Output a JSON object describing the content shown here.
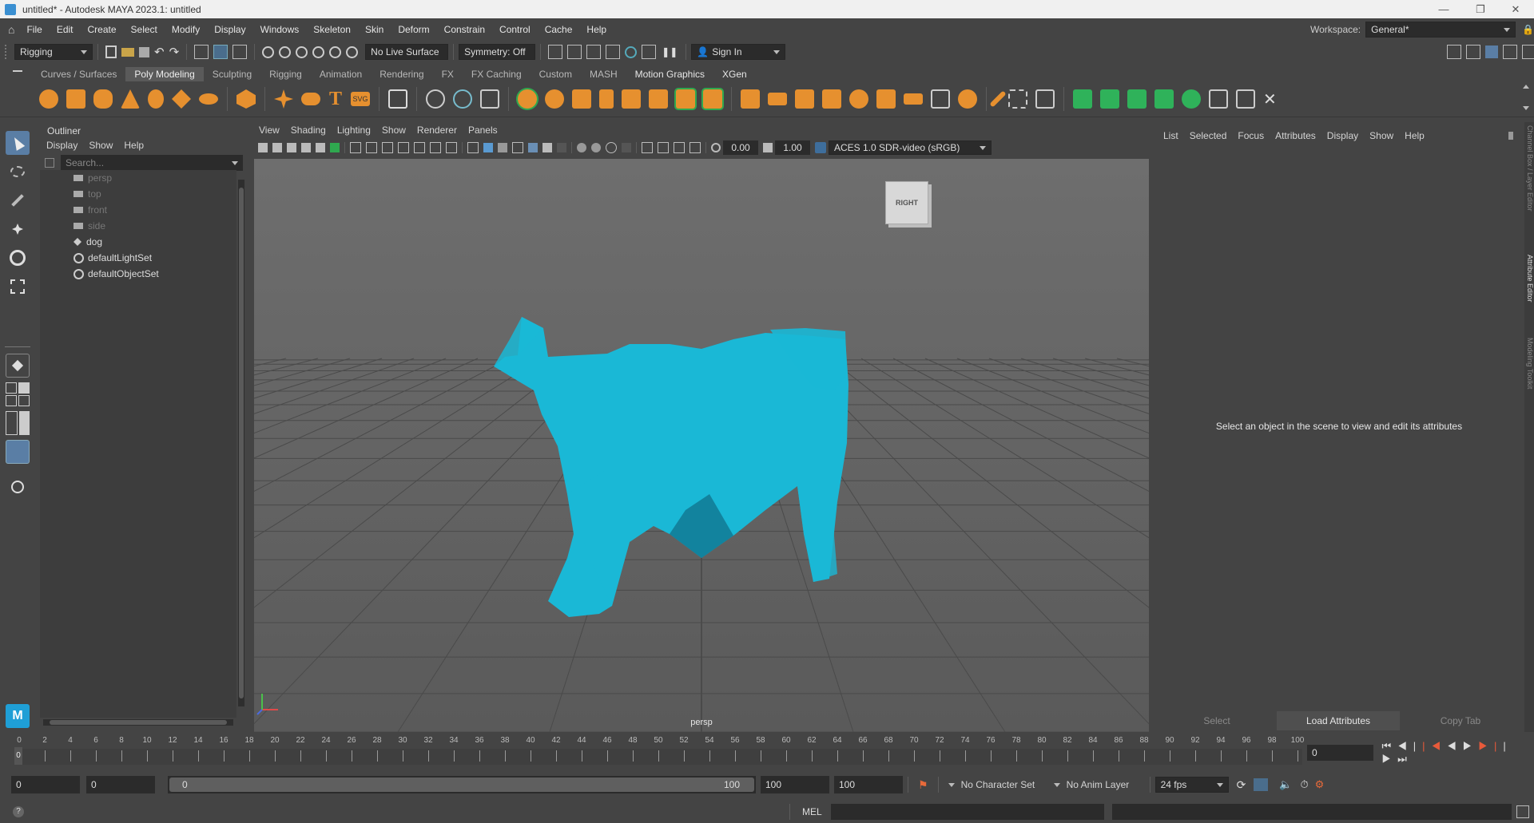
{
  "window": {
    "title": "untitled* - Autodesk MAYA 2023.1: untitled"
  },
  "menubar": {
    "items": [
      "File",
      "Edit",
      "Create",
      "Select",
      "Modify",
      "Display",
      "Windows",
      "Skeleton",
      "Skin",
      "Deform",
      "Constrain",
      "Control",
      "Cache",
      "Help"
    ],
    "workspace_label": "Workspace:",
    "workspace_value": "General*"
  },
  "statusline": {
    "menuset": "Rigging",
    "live_surface": "No Live Surface",
    "symmetry": "Symmetry: Off",
    "sign_in": "Sign In"
  },
  "shelf": {
    "tabs": [
      "Curves / Surfaces",
      "Poly Modeling",
      "Sculpting",
      "Rigging",
      "Animation",
      "Rendering",
      "FX",
      "FX Caching",
      "Custom",
      "MASH",
      "Motion Graphics",
      "XGen"
    ],
    "active_tab": "Poly Modeling"
  },
  "outliner": {
    "title": "Outliner",
    "menu": [
      "Display",
      "Show",
      "Help"
    ],
    "search_placeholder": "Search...",
    "items": [
      {
        "label": "persp",
        "type": "camera",
        "dim": true
      },
      {
        "label": "top",
        "type": "camera",
        "dim": true
      },
      {
        "label": "front",
        "type": "camera",
        "dim": true
      },
      {
        "label": "side",
        "type": "camera",
        "dim": true
      },
      {
        "label": "dog",
        "type": "transform",
        "dim": false
      },
      {
        "label": "defaultLightSet",
        "type": "set",
        "dim": false
      },
      {
        "label": "defaultObjectSet",
        "type": "set",
        "dim": false
      }
    ]
  },
  "viewport": {
    "menu": [
      "View",
      "Shading",
      "Lighting",
      "Show",
      "Renderer",
      "Panels"
    ],
    "exposure": "0.00",
    "gamma": "1.00",
    "color_space": "ACES 1.0 SDR-video (sRGB)",
    "camera_label": "persp",
    "viewcube_label": "RIGHT",
    "model_color": "#1ab8d6"
  },
  "attribute_editor": {
    "menu": [
      "List",
      "Selected",
      "Focus",
      "Attributes",
      "Display",
      "Show",
      "Help"
    ],
    "empty_message": "Select an object in the scene to view and edit its attributes",
    "buttons": [
      "Select",
      "Load Attributes",
      "Copy Tab"
    ],
    "side_tabs": [
      "Channel Box / Layer Editor",
      "Attribute Editor",
      "Modeling Toolkit"
    ]
  },
  "timeslider": {
    "ticks": [
      "0",
      "2",
      "4",
      "6",
      "8",
      "10",
      "12",
      "14",
      "16",
      "18",
      "20",
      "22",
      "24",
      "26",
      "28",
      "30",
      "32",
      "34",
      "36",
      "38",
      "40",
      "42",
      "44",
      "46",
      "48",
      "50",
      "52",
      "54",
      "56",
      "58",
      "60",
      "62",
      "64",
      "66",
      "68",
      "70",
      "72",
      "74",
      "76",
      "78",
      "80",
      "82",
      "84",
      "86",
      "88",
      "90",
      "92",
      "94",
      "96",
      "98",
      "100"
    ],
    "current_frame_marker": "0",
    "current_frame": "0"
  },
  "range": {
    "start": "0",
    "playback_start": "0",
    "range_start_label": "0",
    "range_end_label": "100",
    "playback_end": "100",
    "end": "100",
    "character_set": "No Character Set",
    "anim_layer": "No Anim Layer",
    "fps": "24 fps"
  },
  "cmdline": {
    "language": "MEL"
  }
}
